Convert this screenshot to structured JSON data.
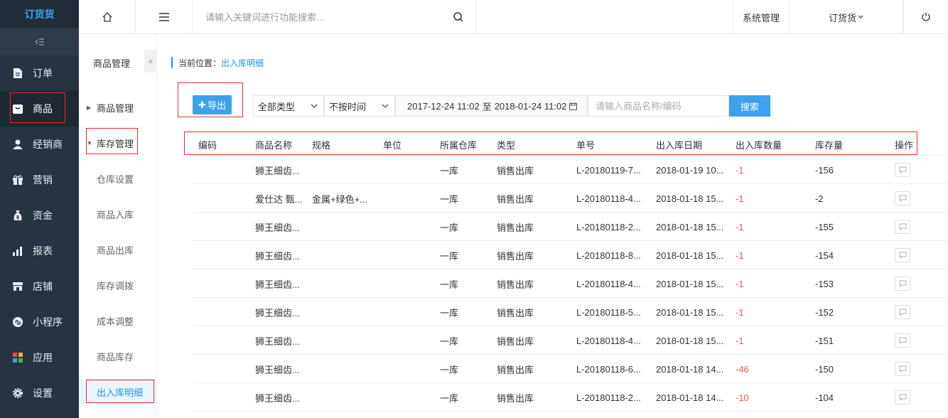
{
  "app": {
    "logo_text": "订货货"
  },
  "topbar": {
    "search_placeholder": "请输入关键词进行功能搜索...",
    "system_manage": "系统管理",
    "user_menu": "订货货",
    "icons": [
      "home-icon",
      "menu-icon",
      "search-icon",
      "power-icon"
    ]
  },
  "sidebar": {
    "items": [
      {
        "label": "订单",
        "icon": "document-icon"
      },
      {
        "label": "商品",
        "icon": "goods-icon",
        "active": true
      },
      {
        "label": "经销商",
        "icon": "user-icon"
      },
      {
        "label": "营销",
        "icon": "gift-icon"
      },
      {
        "label": "资金",
        "icon": "money-bag-icon"
      },
      {
        "label": "报表",
        "icon": "bar-chart-icon"
      },
      {
        "label": "店铺",
        "icon": "store-icon"
      },
      {
        "label": "小程序",
        "icon": "mini-program-icon"
      },
      {
        "label": "应用",
        "icon": "apps-icon"
      },
      {
        "label": "设置",
        "icon": "gear-icon"
      }
    ]
  },
  "subnav": {
    "title": "商品管理",
    "groups": [
      {
        "label": "商品管理"
      },
      {
        "label": "库存管理"
      }
    ],
    "children": [
      {
        "label": "仓库设置"
      },
      {
        "label": "商品入库"
      },
      {
        "label": "商品出库"
      },
      {
        "label": "库存调拨"
      },
      {
        "label": "成本调整"
      },
      {
        "label": "商品库存"
      },
      {
        "label": "出入库明细"
      }
    ]
  },
  "breadcrumb": {
    "prefix": "当前位置：",
    "current": "出入库明细"
  },
  "toolbar": {
    "export_label": "导出",
    "type_select": "全部类型",
    "time_select": "不按时间",
    "date_from": "2017-12-24 11:02",
    "date_sep": "至",
    "date_to": "2018-01-24 11:02",
    "keyword_placeholder": "请输入商品名称/编码",
    "search_label": "搜索"
  },
  "table": {
    "columns": [
      "编码",
      "商品名称",
      "规格",
      "单位",
      "所属仓库",
      "类型",
      "单号",
      "出入库日期",
      "出入库数量",
      "库存量",
      "操作"
    ],
    "rows": [
      {
        "code": "",
        "name": "狮王细齿...",
        "spec": "",
        "unit": "",
        "warehouse": "一库",
        "type": "销售出库",
        "order": "L-20180119-7...",
        "date": "2018-01-19 10...",
        "qty": "-1",
        "stock": "-156"
      },
      {
        "code": "",
        "name": "爱仕达 甄...",
        "spec": "金属+绿色+...",
        "unit": "",
        "warehouse": "一库",
        "type": "销售出库",
        "order": "L-20180118-4...",
        "date": "2018-01-18 15...",
        "qty": "-1",
        "stock": "-2"
      },
      {
        "code": "",
        "name": "狮王细齿...",
        "spec": "",
        "unit": "",
        "warehouse": "一库",
        "type": "销售出库",
        "order": "L-20180118-2...",
        "date": "2018-01-18 15...",
        "qty": "-1",
        "stock": "-155"
      },
      {
        "code": "",
        "name": "狮王细齿...",
        "spec": "",
        "unit": "",
        "warehouse": "一库",
        "type": "销售出库",
        "order": "L-20180118-8...",
        "date": "2018-01-18 15...",
        "qty": "-1",
        "stock": "-154"
      },
      {
        "code": "",
        "name": "狮王细齿...",
        "spec": "",
        "unit": "",
        "warehouse": "一库",
        "type": "销售出库",
        "order": "L-20180118-4...",
        "date": "2018-01-18 15...",
        "qty": "-1",
        "stock": "-153"
      },
      {
        "code": "",
        "name": "狮王细齿...",
        "spec": "",
        "unit": "",
        "warehouse": "一库",
        "type": "销售出库",
        "order": "L-20180118-5...",
        "date": "2018-01-18 15...",
        "qty": "-1",
        "stock": "-152"
      },
      {
        "code": "",
        "name": "狮王细齿...",
        "spec": "",
        "unit": "",
        "warehouse": "一库",
        "type": "销售出库",
        "order": "L-20180118-4...",
        "date": "2018-01-18 15...",
        "qty": "-1",
        "stock": "-151"
      },
      {
        "code": "",
        "name": "狮王细齿...",
        "spec": "",
        "unit": "",
        "warehouse": "一库",
        "type": "销售出库",
        "order": "L-20180118-6...",
        "date": "2018-01-18 14...",
        "qty": "-46",
        "stock": "-150"
      },
      {
        "code": "",
        "name": "狮王细齿...",
        "spec": "",
        "unit": "",
        "warehouse": "一库",
        "type": "销售出库",
        "order": "L-20180118-2...",
        "date": "2018-01-18 14...",
        "qty": "-10",
        "stock": "-104"
      }
    ]
  },
  "colors": {
    "accent": "#3aa3ec",
    "sidebar_bg": "#283341",
    "negative": "#e85d4a",
    "highlight_box": "#e0312f"
  }
}
